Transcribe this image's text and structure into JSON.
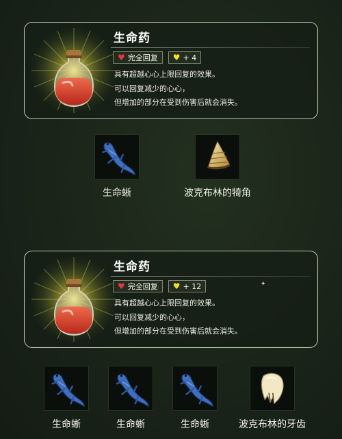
{
  "recipes": [
    {
      "name": "生命药",
      "badge_full": "完全回复",
      "badge_bonus": "+ 4",
      "description": [
        "具有超越心心上限回复的效果。",
        "可以回复减少的心心，",
        "但增加的部分在受到伤害后就会消失。"
      ],
      "ingredients": [
        {
          "label": "生命蜥",
          "icon": "blue-lizard-icon"
        },
        {
          "label": "波克布林的犄角",
          "icon": "bokoblin-horn-icon"
        }
      ]
    },
    {
      "name": "生命药",
      "badge_full": "完全回复",
      "badge_bonus": "+ 12",
      "description": [
        "具有超越心心上限回复的效果。",
        "可以回复减少的心心，",
        "但增加的部分在受到伤害后就会消失。"
      ],
      "ingredients": [
        {
          "label": "生命蜥",
          "icon": "blue-lizard-icon"
        },
        {
          "label": "生命蜥",
          "icon": "blue-lizard-icon"
        },
        {
          "label": "生命蜥",
          "icon": "blue-lizard-icon"
        },
        {
          "label": "波克布林的牙齿",
          "icon": "bokoblin-fang-icon"
        }
      ]
    }
  ]
}
